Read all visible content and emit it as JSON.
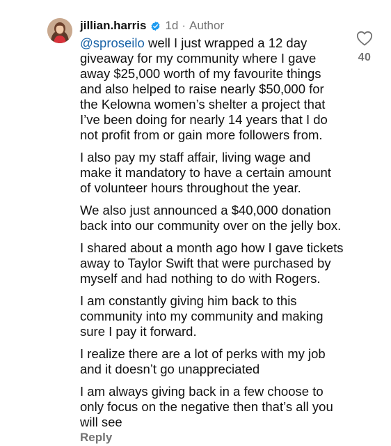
{
  "comment": {
    "username": "jillian.harris",
    "time": "1d",
    "separator": "·",
    "role": "Author",
    "mention": "@sproseilo",
    "paragraphs": [
      " well I just wrapped a 12 day giveaway for my community where I gave away $25,000 worth of my favourite things and also helped to raise nearly $50,000 for the Kelowna women’s shelter a project that I’ve been doing for nearly 14 years that I do not profit from or gain more followers from.",
      "I also pay my staff affair, living wage and make it mandatory to have a certain amount of volunteer hours throughout the year.",
      "We also just announced a $40,000 donation back into our community over on the jelly box.",
      "I shared about a month ago how I gave tickets away to Taylor Swift that were purchased by myself and had nothing to do with Rogers.",
      "I am constantly giving him back to this community into my community and making sure I pay it forward.",
      "I realize there are a lot of perks with my job and it doesn’t go unappreciated",
      "I am always giving back in a few choose to only focus on the negative then that’s all you will see"
    ],
    "likes": "40",
    "reply_label": "Reply"
  },
  "icons": {
    "avatar": "profile-photo",
    "verified": "verified-badge-icon",
    "like": "heart-outline-icon"
  },
  "colors": {
    "text": "#111111",
    "muted": "#737373",
    "mention": "#1a64a8",
    "verified": "#1d9bf0"
  }
}
